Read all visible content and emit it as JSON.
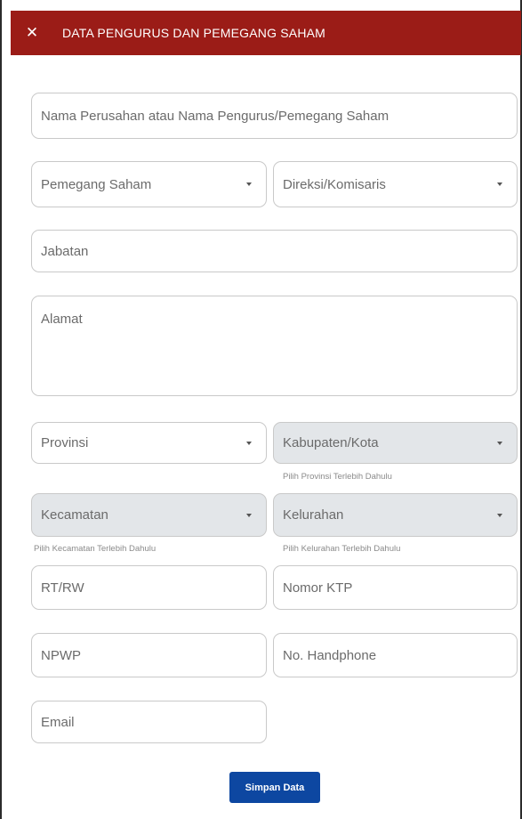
{
  "header": {
    "title": "DATA PENGURUS DAN PEMEGANG SAHAM",
    "close_symbol": "✕",
    "background_color": "#9b1c17"
  },
  "form": {
    "nama": {
      "placeholder": "Nama Perusahan atau Nama Pengurus/Pemegang Saham"
    },
    "pemegang_saham": {
      "selected": "Pemegang Saham"
    },
    "direksi_komisaris": {
      "selected": "Direksi/Komisaris"
    },
    "jabatan": {
      "placeholder": "Jabatan"
    },
    "alamat": {
      "placeholder": "Alamat"
    },
    "provinsi": {
      "selected": "Provinsi"
    },
    "kabupaten_kota": {
      "selected": "Kabupaten/Kota",
      "hint": "Pilih Provinsi Terlebih Dahulu"
    },
    "kecamatan": {
      "selected": "Kecamatan",
      "hint": "Pilih Kecamatan Terlebih Dahulu"
    },
    "kelurahan": {
      "selected": "Kelurahan",
      "hint": "Pilih Kelurahan Terlebih Dahulu"
    },
    "rt_rw": {
      "placeholder": "RT/RW"
    },
    "nomor_ktp": {
      "placeholder": "Nomor KTP"
    },
    "npwp": {
      "placeholder": "NPWP"
    },
    "no_handphone": {
      "placeholder": "No. Handphone"
    },
    "email": {
      "placeholder": "Email"
    }
  },
  "actions": {
    "save_label": "Simpan Data",
    "save_color": "#0d47a1"
  },
  "colors": {
    "disabled_field": "#e3e6e9",
    "border": "#c9c9c9"
  }
}
